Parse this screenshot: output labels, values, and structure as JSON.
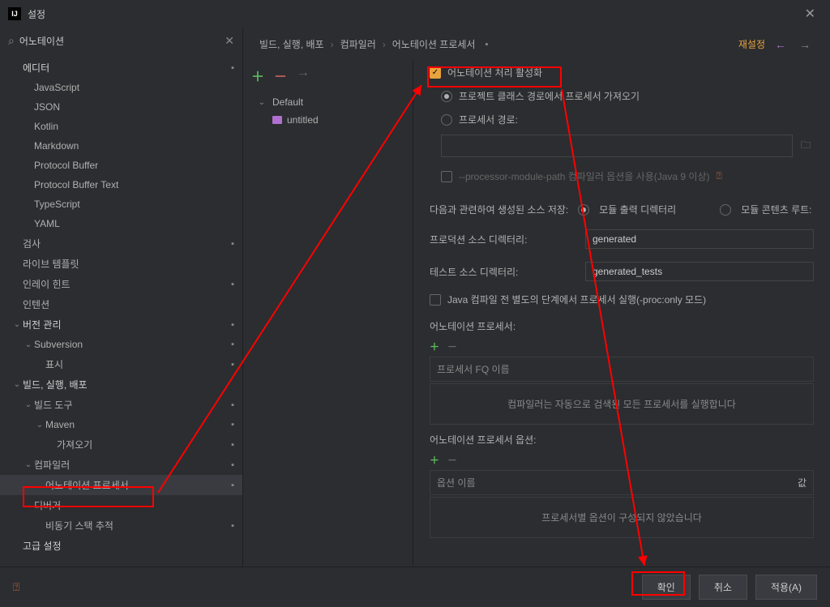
{
  "titlebar": {
    "icon_text": "IJ",
    "title": "설정"
  },
  "search": {
    "value": "어노테이션"
  },
  "sidebar": {
    "editor_label": "에디터",
    "editor_children": [
      "JavaScript",
      "JSON",
      "Kotlin",
      "Markdown",
      "Protocol Buffer",
      "Protocol Buffer Text",
      "TypeScript",
      "YAML"
    ],
    "inspection": "검사",
    "live_templates": "라이브 템플릿",
    "inlay_hints": "인레이 힌트",
    "intentions": "인텐션",
    "vcs": "버전 관리",
    "subversion": "Subversion",
    "subversion_presentation": "표시",
    "build": "빌드, 실행, 배포",
    "build_tools": "빌드 도구",
    "maven": "Maven",
    "maven_import": "가져오기",
    "compiler": "컴파일러",
    "annotation_processors": "어노테이션 프로세서",
    "debugger": "디버거",
    "async_stack": "비동기 스택 추적",
    "advanced": "고급 설정"
  },
  "breadcrumb": {
    "a": "빌드, 실행, 배포",
    "b": "컴파일러",
    "c": "어노테이션 프로세서",
    "reset": "재설정"
  },
  "profiles": {
    "default": "Default",
    "untitled": "untitled"
  },
  "settings": {
    "enable": "어노테이션 처리 활성화",
    "radio1": "프로젝트 클래스 경로에서 프로세서 가져오기",
    "radio2": "프로세서 경로:",
    "checkpath": "--processor-module-path 컴파일러 옵션을 사용(Java 9 이상)",
    "gen_source": "다음과 관련하여 생성된 소스 저장:",
    "gen_module": "모듈 출력 디렉터리",
    "gen_content": "모듈 콘텐츠 루트:",
    "prod_dir_label": "프로덕션 소스 디렉터리:",
    "prod_dir_value": "generated",
    "test_dir_label": "테스트 소스 디렉터리:",
    "test_dir_value": "generated_tests",
    "proc_only": "Java 컴파일 전 별도의 단계에서 프로세서 실행(-proc:only 모드)",
    "ann_proc": "어노테이션 프로세서:",
    "fq_placeholder": "프로세서 FQ 이름",
    "fq_hint": "컴파일러는 자동으로 검색된 모든 프로세서를 실행합니다",
    "proc_options": "어노테이션 프로세서 옵션:",
    "opt_name": "옵션 이름",
    "opt_value": "값",
    "opt_hint": "프로세서별 옵션이 구성되지 않았습니다"
  },
  "footer": {
    "ok": "확인",
    "cancel": "취소",
    "apply": "적용(A)"
  }
}
